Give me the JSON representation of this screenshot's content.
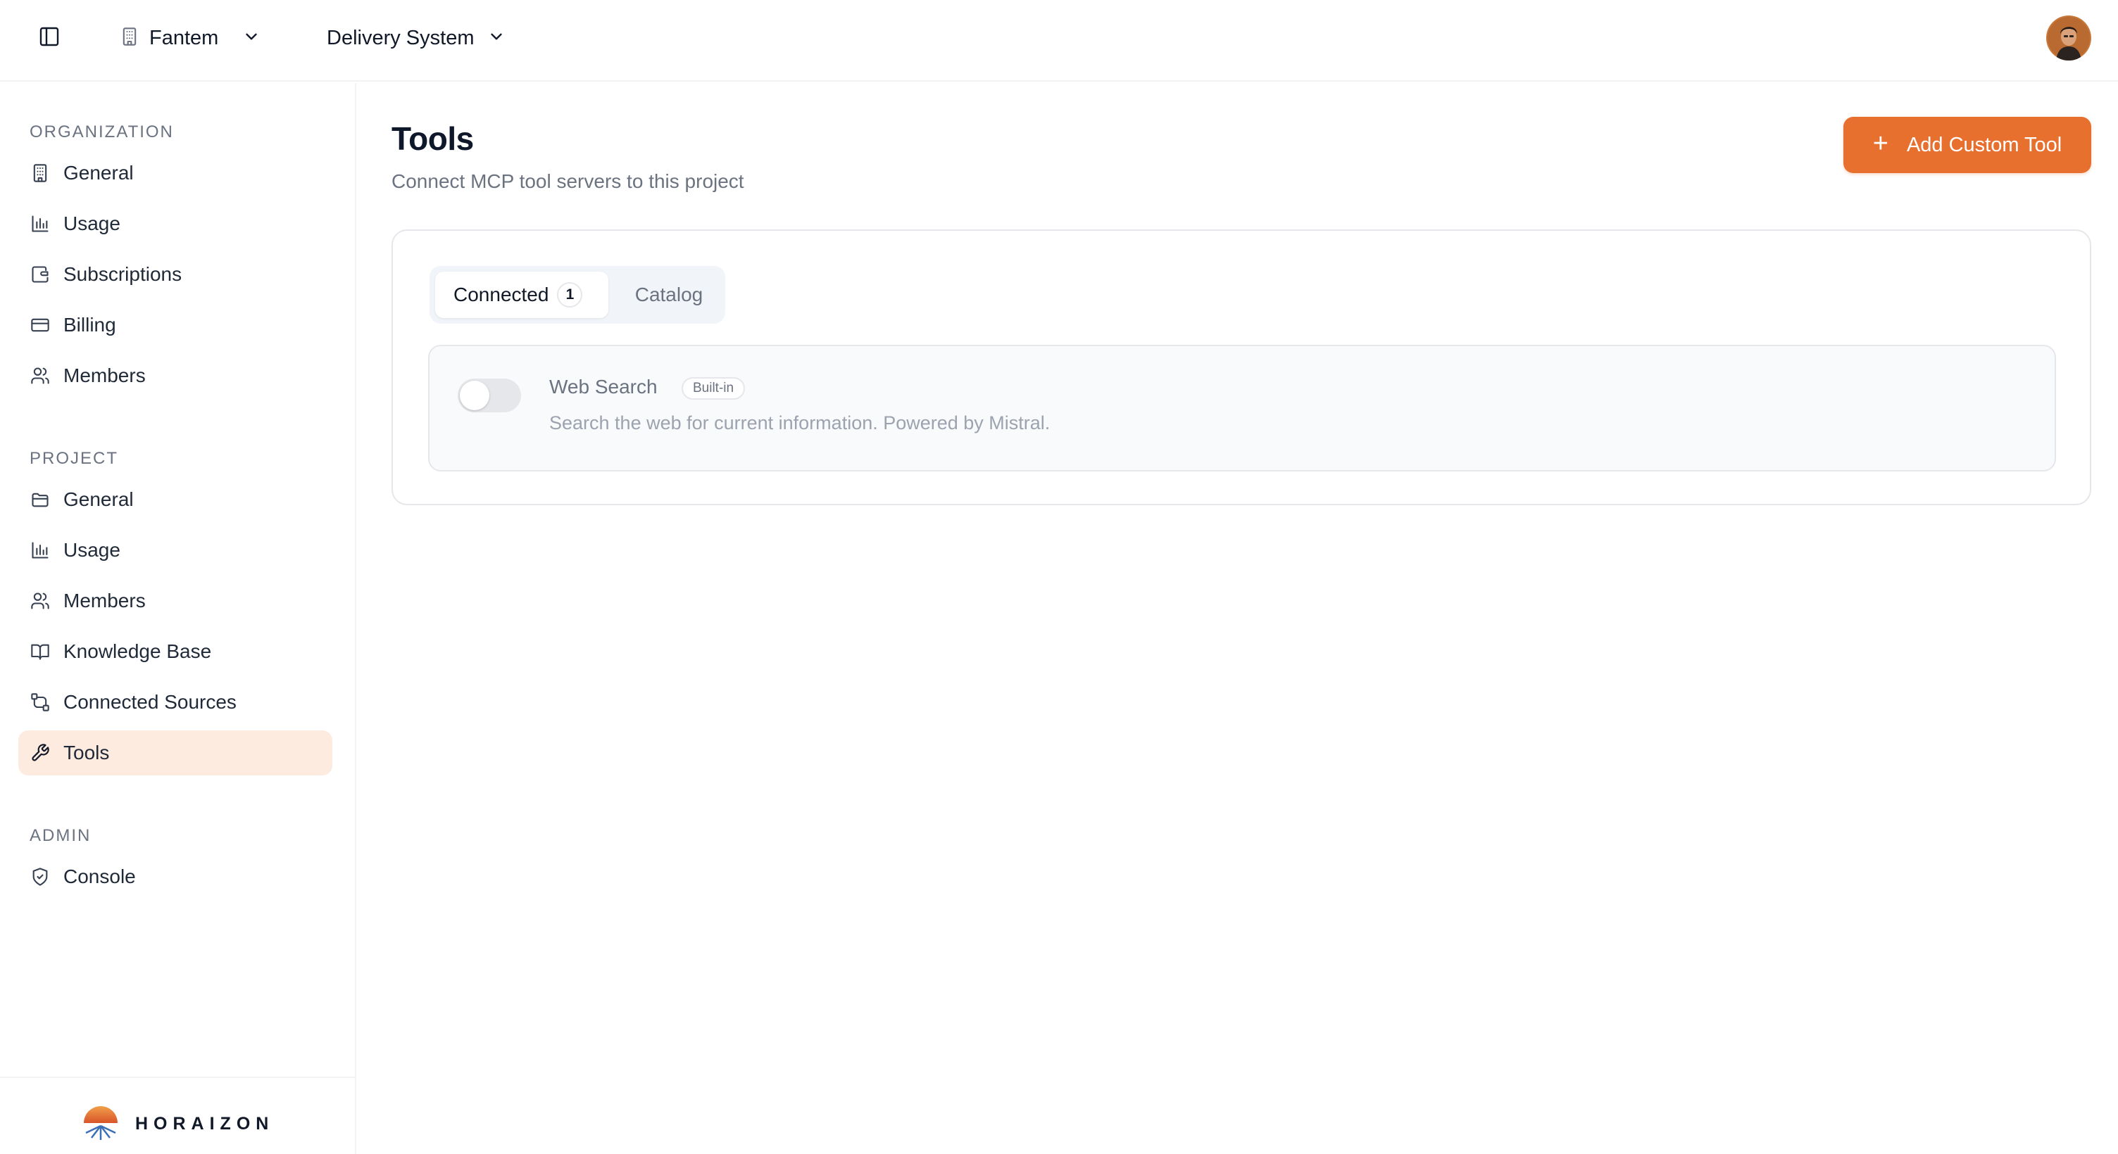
{
  "topbar": {
    "org_name": "Fantem",
    "project_name": "Delivery System"
  },
  "sidebar": {
    "organization_label": "ORGANIZATION",
    "organization_items": [
      {
        "label": "General",
        "icon": "building-icon"
      },
      {
        "label": "Usage",
        "icon": "bar-chart-icon"
      },
      {
        "label": "Subscriptions",
        "icon": "wallet-icon"
      },
      {
        "label": "Billing",
        "icon": "credit-card-icon"
      },
      {
        "label": "Members",
        "icon": "users-icon"
      }
    ],
    "project_label": "PROJECT",
    "project_items": [
      {
        "label": "General",
        "icon": "folder-icon"
      },
      {
        "label": "Usage",
        "icon": "bar-chart-icon"
      },
      {
        "label": "Members",
        "icon": "users-icon"
      },
      {
        "label": "Knowledge Base",
        "icon": "book-icon"
      },
      {
        "label": "Connected Sources",
        "icon": "route-icon"
      },
      {
        "label": "Tools",
        "icon": "wrench-icon",
        "active": true
      }
    ],
    "admin_label": "ADMIN",
    "admin_items": [
      {
        "label": "Console",
        "icon": "shield-icon"
      }
    ],
    "brand": "HORAIZON"
  },
  "main": {
    "title": "Tools",
    "subtitle": "Connect MCP tool servers to this project",
    "add_button_label": "Add Custom Tool",
    "tabs": {
      "connected_label": "Connected",
      "connected_count": "1",
      "catalog_label": "Catalog"
    },
    "tools": [
      {
        "name": "Web Search",
        "badge": "Built-in",
        "description": "Search the web for current information. Powered by Mistral.",
        "enabled": false
      }
    ]
  },
  "colors": {
    "accent": "#e8702f",
    "active_nav_bg": "#fdebe0",
    "border": "#e5e7eb",
    "muted_text": "#6b7280"
  }
}
